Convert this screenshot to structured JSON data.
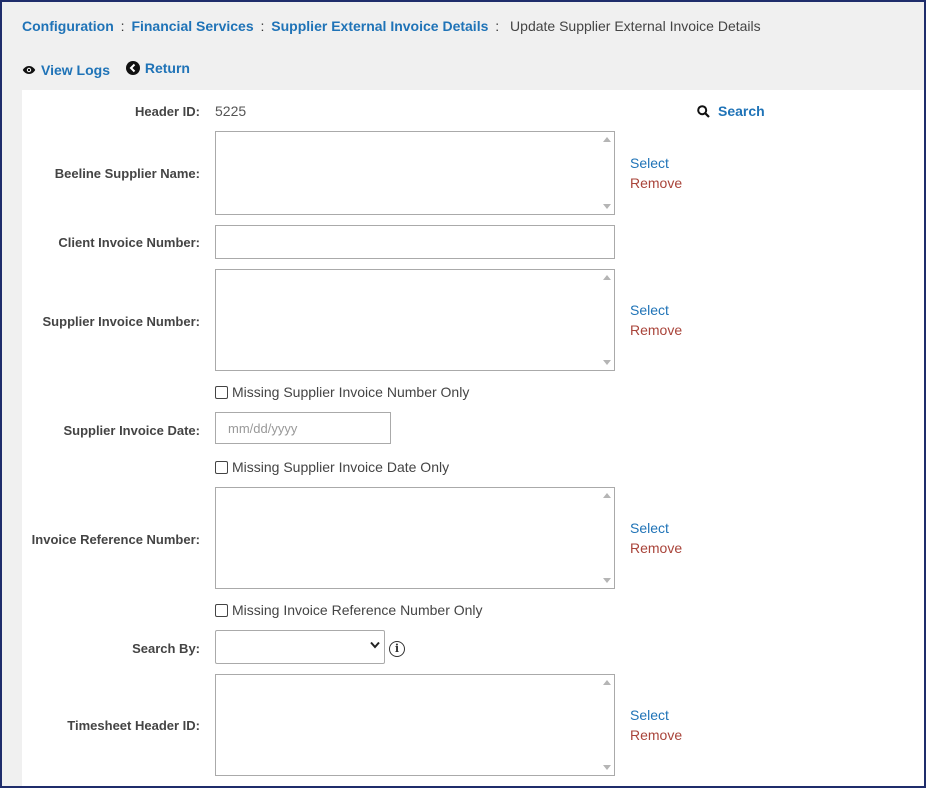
{
  "breadcrumb": {
    "items": [
      "Configuration",
      "Financial Services",
      "Supplier External Invoice Details"
    ],
    "separator": ":",
    "current": "Update Supplier External Invoice Details"
  },
  "actions": {
    "view_logs": "View Logs",
    "return": "Return"
  },
  "form": {
    "header_id": {
      "label": "Header ID:",
      "value": "5225"
    },
    "search_label": "Search",
    "beeline_supplier_name": {
      "label": "Beeline Supplier Name:",
      "select": "Select",
      "remove": "Remove"
    },
    "client_invoice_number": {
      "label": "Client Invoice Number:"
    },
    "supplier_invoice_number": {
      "label": "Supplier Invoice Number:",
      "select": "Select",
      "remove": "Remove"
    },
    "missing_supplier_invoice_number": "Missing Supplier Invoice Number Only",
    "supplier_invoice_date": {
      "label": "Supplier Invoice Date:",
      "placeholder": "mm/dd/yyyy"
    },
    "missing_supplier_invoice_date": "Missing Supplier Invoice Date Only",
    "invoice_reference_number": {
      "label": "Invoice Reference Number:",
      "select": "Select",
      "remove": "Remove"
    },
    "missing_invoice_reference_number": "Missing Invoice Reference Number Only",
    "search_by": {
      "label": "Search By:",
      "value": ""
    },
    "timesheet_header_id": {
      "label": "Timesheet Header ID:",
      "select": "Select",
      "remove": "Remove"
    }
  },
  "colors": {
    "link": "#1f73b7",
    "remove": "#a9443a",
    "frame_border": "#1f2d6b"
  },
  "icons": [
    "eye-icon",
    "return-arrow-icon",
    "search-icon",
    "info-icon",
    "chevron-down-icon"
  ]
}
